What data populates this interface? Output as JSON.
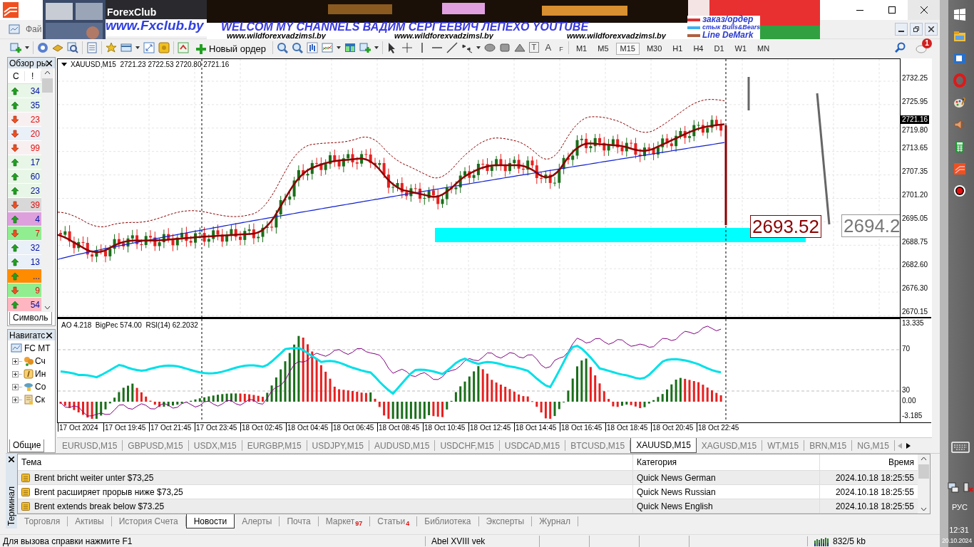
{
  "title_bar": {
    "banner": {
      "kind": "picture",
      "brand": "ForexClub",
      "site": "www.Fxclub.by",
      "headline": "WELCOM MY CHANNELS ВАДИМ СЕРГЕЕВИЧ ЛЕПЕХО YOUTUBE",
      "links": [
        "www.wildforexvadzimsl.by",
        "www.wildforexvadzimsl.by",
        "www.wildforexvadzimsl.by"
      ],
      "legend": [
        {
          "label": "заказ/ордер",
          "color": "#e03030"
        },
        {
          "label": "стык Bulls&Bears",
          "color": "#40b0f0"
        },
        {
          "label": "Line DeMark",
          "color": "#b06040"
        }
      ]
    }
  },
  "menu": {
    "items": [
      "Фай"
    ]
  },
  "toolbar": {
    "new_order": "Новый ордер",
    "tool_letters": [
      "T",
      "A",
      "F"
    ],
    "timeframes": [
      {
        "label": "M1",
        "selected": false
      },
      {
        "label": "M5",
        "selected": false
      },
      {
        "label": "M15",
        "selected": true
      },
      {
        "label": "M30",
        "selected": false
      },
      {
        "label": "H1",
        "selected": false
      },
      {
        "label": "H4",
        "selected": false
      },
      {
        "label": "D1",
        "selected": false
      },
      {
        "label": "W1",
        "selected": false
      },
      {
        "label": "MN",
        "selected": false
      }
    ],
    "notifications": "1"
  },
  "market_watch": {
    "title": "Обзор ры",
    "columns": [
      "С",
      "!"
    ],
    "rows": [
      {
        "rising": true,
        "value": "34",
        "color": "#e8f6e8"
      },
      {
        "rising": true,
        "value": "35",
        "color": "#e8f6e8"
      },
      {
        "rising": false,
        "value": "23",
        "color": "#f8f0f0"
      },
      {
        "rising": false,
        "value": "20",
        "color": "#eaf0f8"
      },
      {
        "rising": false,
        "value": "99",
        "color": "#f8f0f0"
      },
      {
        "rising": true,
        "value": "17",
        "color": "#e8f6e8"
      },
      {
        "rising": true,
        "value": "60",
        "color": "#e8f6e8"
      },
      {
        "rising": true,
        "value": "23",
        "color": "#e8f6e8"
      },
      {
        "rising": false,
        "value": "39",
        "color": "#d8d8d8"
      },
      {
        "rising": true,
        "value": "4",
        "color": "#dda0dd"
      },
      {
        "rising": false,
        "value": "7",
        "color": "#90ee90"
      },
      {
        "rising": true,
        "value": "32",
        "color": "#eaf0f8"
      },
      {
        "rising": true,
        "value": "13",
        "color": "#eaf0f8"
      },
      {
        "rising": true,
        "value": "...",
        "color": "#ff8c00"
      },
      {
        "rising": false,
        "value": "9",
        "color": "#90ee90"
      },
      {
        "rising": true,
        "value": "54",
        "color": "#ffb6c1"
      }
    ],
    "tab": "Символь"
  },
  "navigator": {
    "title": "Навигатс",
    "root": "FC MT",
    "children": [
      {
        "label": "Сч",
        "expanded": false
      },
      {
        "label": "Ин",
        "expanded": false
      },
      {
        "label": "Со",
        "expanded": false
      },
      {
        "label": "Ск",
        "expanded": false
      }
    ],
    "tab": "Общие"
  },
  "chart": {
    "header": "XAUUSD,M15  2721.23 2722.53 2720.80 2721.16",
    "price_axis": [
      "2732.25",
      "2725.95",
      "2719.80",
      "2713.65",
      "2707.35",
      "2701.20",
      "2695.05",
      "2688.75",
      "2682.60",
      "2676.30",
      "2670.15"
    ],
    "current_price": "2721.16",
    "price_labels": [
      "2693.52",
      "2694.2"
    ],
    "indicator_header": "AO 4.218  BigPec 574.00  RSI(14) 62.2032",
    "indicator_axis": [
      "13.335",
      "70",
      "30",
      "0.00",
      "-3.185"
    ],
    "time_axis": [
      "17 Oct 2024",
      "17 Oct 19:45",
      "17 Oct 21:45",
      "17 Oct 23:45",
      "18 Oct 02:45",
      "18 Oct 04:45",
      "18 Oct 06:45",
      "18 Oct 08:45",
      "18 Oct 10:45",
      "18 Oct 12:45",
      "18 Oct 14:45",
      "18 Oct 16:45",
      "18 Oct 18:45",
      "18 Oct 20:45",
      "18 Oct 22:45"
    ]
  },
  "symbol_tabs": [
    {
      "label": "EURUSD,M15",
      "selected": false
    },
    {
      "label": "GBPUSD,M15",
      "selected": false
    },
    {
      "label": "USDX,M15",
      "selected": false
    },
    {
      "label": "EURGBP,M15",
      "selected": false
    },
    {
      "label": "USDJPY,M15",
      "selected": false
    },
    {
      "label": "AUDUSD,M15",
      "selected": false
    },
    {
      "label": "USDCHF,M15",
      "selected": false
    },
    {
      "label": "USDCAD,M15",
      "selected": false
    },
    {
      "label": "BTCUSD,M15",
      "selected": false
    },
    {
      "label": "XAUUSD,M15",
      "selected": true
    },
    {
      "label": "XAGUSD,M15",
      "selected": false
    },
    {
      "label": "WT,M15",
      "selected": false
    },
    {
      "label": "BRN,M15",
      "selected": false
    },
    {
      "label": "NG,M15",
      "selected": false
    }
  ],
  "terminal": {
    "title": "Терминал",
    "columns": [
      "Тема",
      "Категория",
      "Время"
    ],
    "rows": [
      {
        "subject": "Brent bricht weiter unter $73,25",
        "category": "Quick News German",
        "time": "2024.10.18 18:25:55"
      },
      {
        "subject": "Brent расширяет прорыв ниже $73,25",
        "category": "Quick News Russian",
        "time": "2024.10.18 18:25:55"
      },
      {
        "subject": "Brent extends break below $73.25",
        "category": "Quick News English",
        "time": "2024.10.18 18:25:55"
      }
    ],
    "tabs": [
      {
        "label": "Торговля",
        "selected": false
      },
      {
        "label": "Активы",
        "selected": false
      },
      {
        "label": "История Счета",
        "selected": false
      },
      {
        "label": "Новости",
        "selected": true
      },
      {
        "label": "Алерты",
        "selected": false
      },
      {
        "label": "Почта",
        "selected": false
      },
      {
        "label": "Маркет",
        "badge": "97",
        "selected": false
      },
      {
        "label": "Статьи",
        "badge": "4",
        "selected": false
      },
      {
        "label": "Библиотека",
        "selected": false
      },
      {
        "label": "Эксперты",
        "selected": false
      },
      {
        "label": "Журнал",
        "selected": false
      }
    ]
  },
  "status_bar": {
    "help": "Для вызова справки нажмите F1",
    "profile": "Abel XVIII vek",
    "traffic": "832/5 kb"
  },
  "taskbar": {
    "language": "РУС",
    "time": "12:31",
    "date": "20.10.2024"
  }
}
